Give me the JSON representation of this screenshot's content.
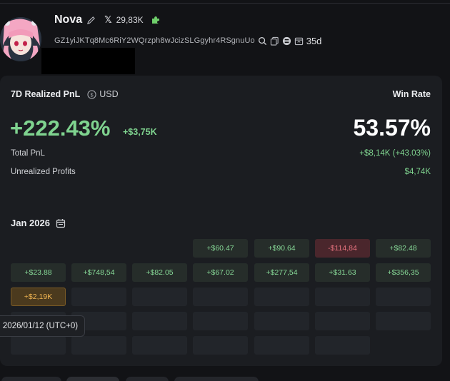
{
  "profile": {
    "name": "Nova",
    "x_followers": "29,83K",
    "address": "GZ1yiJKTq8Mc6RiY2WQrzph8wJcizSLGgyhr4RSgnuUo",
    "age": "35d"
  },
  "pnl": {
    "title": "7D Realized PnL",
    "currency": "USD",
    "percent": "+222.43%",
    "amount": "+$3,75K",
    "win_rate_label": "Win Rate",
    "win_rate": "53.57%",
    "total_label": "Total PnL",
    "total_value": "+$8,14K (+43.03%)",
    "unrealized_label": "Unrealized Profits",
    "unrealized_value": "$4,74K"
  },
  "calendar": {
    "month": "Jan 2026",
    "tooltip": "2026/01/12 (UTC+0)",
    "row1": [
      "",
      "",
      "",
      "+$60.47",
      "+$90.64",
      "-$114,84",
      "+$82.48"
    ],
    "row2": [
      "+$23.88",
      "+$748,54",
      "+$82.05",
      "+$67.02",
      "+$277,54",
      "+$31.63",
      "+$356,35"
    ],
    "row3": [
      "+$2,19K",
      "",
      "",
      "",
      "",
      "",
      ""
    ]
  },
  "colors": {
    "positive": "#7fd38f",
    "negative": "#e6727e",
    "highlight": "#f0b552",
    "background": "#121316",
    "card": "#1b1d21"
  }
}
